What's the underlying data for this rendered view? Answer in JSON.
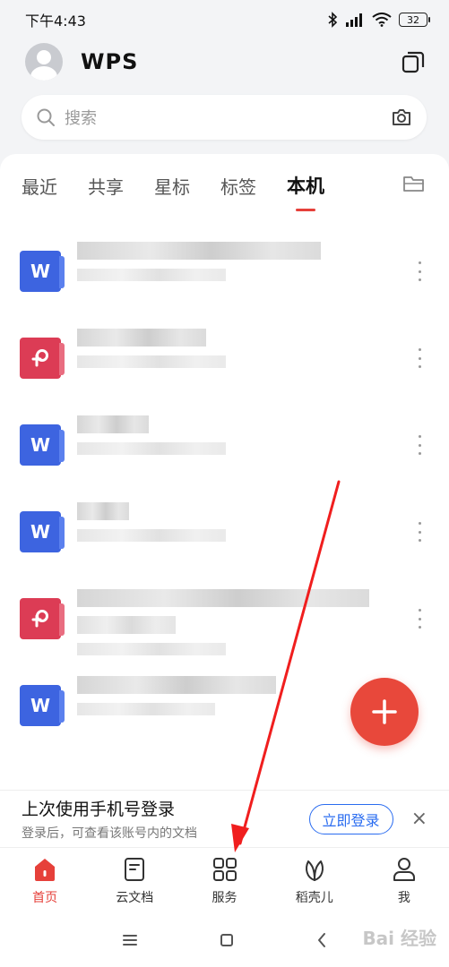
{
  "status_bar": {
    "time": "下午4:43",
    "battery": "32"
  },
  "header": {
    "logo": "WPS"
  },
  "search": {
    "placeholder": "搜索"
  },
  "tabs": [
    {
      "label": "最近"
    },
    {
      "label": "共享"
    },
    {
      "label": "星标"
    },
    {
      "label": "标签"
    },
    {
      "label": "本机"
    }
  ],
  "active_tab": "本机",
  "files": [
    {
      "type": "word",
      "icon_letter": "W"
    },
    {
      "type": "pdf",
      "icon_letter": "P"
    },
    {
      "type": "word",
      "icon_letter": "W"
    },
    {
      "type": "word",
      "icon_letter": "W"
    },
    {
      "type": "pdf",
      "icon_letter": "P"
    },
    {
      "type": "word",
      "icon_letter": "W"
    }
  ],
  "login_banner": {
    "title": "上次使用手机号登录",
    "subtitle": "登录后，可查看该账号内的文档",
    "button": "立即登录",
    "close": "×"
  },
  "bottom_nav": [
    {
      "label": "首页"
    },
    {
      "label": "云文档"
    },
    {
      "label": "服务"
    },
    {
      "label": "稻壳儿"
    },
    {
      "label": "我"
    }
  ],
  "watermark": "Bai 经验",
  "colors": {
    "accent": "#e6403a",
    "fab": "#e8483b",
    "word_icon": "#3d64e0",
    "pdf_icon": "#dc3c55",
    "login_button": "#2a6cf0"
  }
}
